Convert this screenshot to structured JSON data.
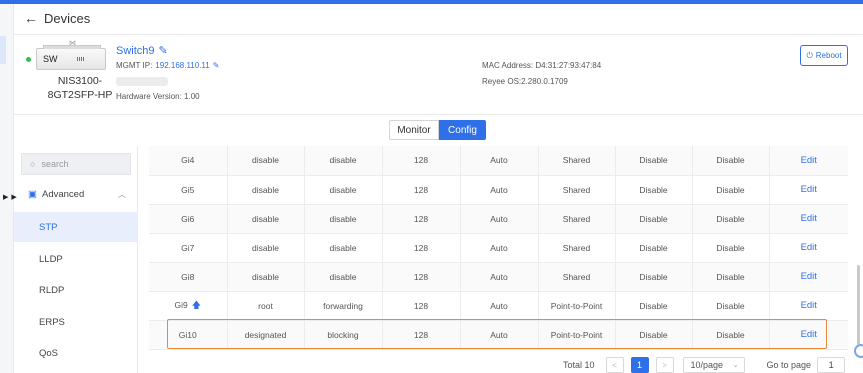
{
  "header": {
    "back_icon": "arrow-left-icon",
    "title": "Devices"
  },
  "device": {
    "status_color": "#2fbf56",
    "icon_label": "SW",
    "model_line1": "NIS3100-",
    "model_line2": "8GT2SFP-HP",
    "name": "Switch9",
    "mgmt_label": "MGMT IP:",
    "mgmt_ip": "192.168.110.11",
    "hardware": "Hardware Version: 1.00",
    "mac": "MAC Address: D4:31:27:93:47:84",
    "os": "Reyee OS:2.280.0.1709",
    "reboot_label": "Reboot"
  },
  "tabs": [
    {
      "label": "Monitor",
      "active": false
    },
    {
      "label": "Config",
      "active": true
    }
  ],
  "sidebar": {
    "search_placeholder": "search",
    "section": "Advanced",
    "items": [
      {
        "label": "STP",
        "active": true
      },
      {
        "label": "LLDP",
        "active": false
      },
      {
        "label": "RLDP",
        "active": false
      },
      {
        "label": "ERPS",
        "active": false
      },
      {
        "label": "QoS",
        "active": false
      }
    ]
  },
  "table": {
    "rows": [
      {
        "port": "Gi4",
        "role": "disable",
        "state": "disable",
        "priority": "128",
        "cost": "Auto",
        "link": "Shared",
        "edge": "Disable",
        "bpdu": "Disable",
        "action": "Edit"
      },
      {
        "port": "Gi5",
        "role": "disable",
        "state": "disable",
        "priority": "128",
        "cost": "Auto",
        "link": "Shared",
        "edge": "Disable",
        "bpdu": "Disable",
        "action": "Edit"
      },
      {
        "port": "Gi6",
        "role": "disable",
        "state": "disable",
        "priority": "128",
        "cost": "Auto",
        "link": "Shared",
        "edge": "Disable",
        "bpdu": "Disable",
        "action": "Edit"
      },
      {
        "port": "Gi7",
        "role": "disable",
        "state": "disable",
        "priority": "128",
        "cost": "Auto",
        "link": "Shared",
        "edge": "Disable",
        "bpdu": "Disable",
        "action": "Edit"
      },
      {
        "port": "Gi8",
        "role": "disable",
        "state": "disable",
        "priority": "128",
        "cost": "Auto",
        "link": "Shared",
        "edge": "Disable",
        "bpdu": "Disable",
        "action": "Edit"
      },
      {
        "port": "Gi9",
        "role": "root",
        "state": "forwarding",
        "priority": "128",
        "cost": "Auto",
        "link": "Point-to-Point",
        "edge": "Disable",
        "bpdu": "Disable",
        "action": "Edit",
        "root_icon": "arrow-up-icon"
      },
      {
        "port": "Gi10",
        "role": "designated",
        "state": "blocking",
        "priority": "128",
        "cost": "Auto",
        "link": "Point-to-Point",
        "edge": "Disable",
        "bpdu": "Disable",
        "action": "Edit"
      }
    ]
  },
  "pagination": {
    "total": "Total 10",
    "prev_icon": "chevron-left-icon",
    "current": "1",
    "next_icon": "chevron-right-icon",
    "page_size": "10/page",
    "goto_label": "Go to page",
    "goto_value": "1"
  },
  "colors": {
    "accent": "#2f6fe8",
    "highlight": "#e8893a"
  }
}
